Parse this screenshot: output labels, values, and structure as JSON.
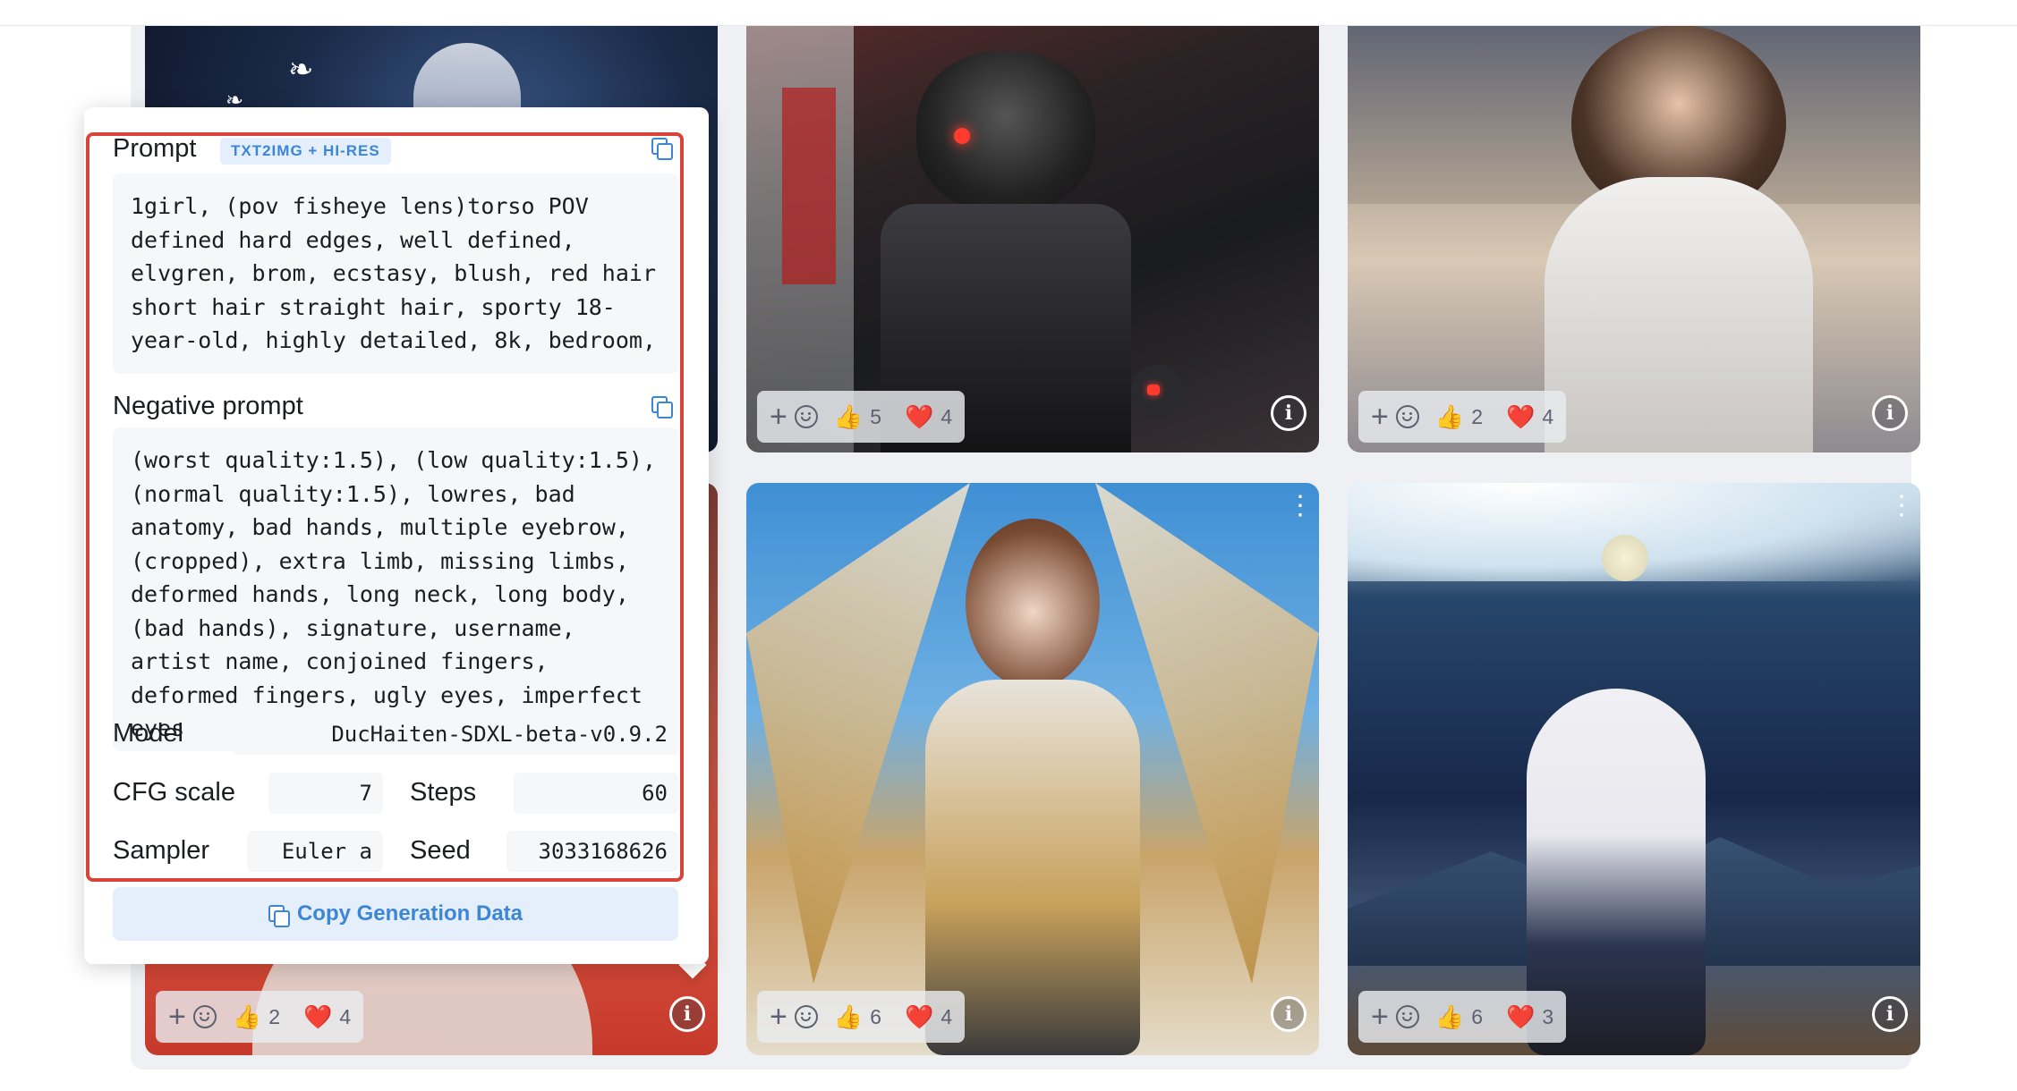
{
  "gallery": {
    "cards": [
      {
        "id": "card-1",
        "thumbs": "",
        "hearts": ""
      },
      {
        "id": "card-2",
        "thumbs": "5",
        "hearts": "4"
      },
      {
        "id": "card-3",
        "thumbs": "2",
        "hearts": "4"
      },
      {
        "id": "card-4",
        "thumbs": "2",
        "hearts": "4"
      },
      {
        "id": "card-5",
        "thumbs": "6",
        "hearts": "4"
      },
      {
        "id": "card-6",
        "thumbs": "6",
        "hearts": "3"
      }
    ],
    "thumbs_emoji": "👍",
    "heart_emoji": "❤️",
    "plus_glyph": "+",
    "info_glyph": "i"
  },
  "popover": {
    "prompt_label": "Prompt",
    "prompt_badge": "TXT2IMG + HI-RES",
    "prompt_text": "1girl, (pov fisheye lens)torso POV defined hard edges, well defined, elvgren, brom, ecstasy, blush, red hair short hair straight hair, sporty 18-year-old, highly detailed, 8k, bedroom,",
    "negative_label": "Negative prompt",
    "negative_text": "(worst quality:1.5), (low quality:1.5), (normal quality:1.5), lowres, bad anatomy, bad hands, multiple eyebrow, (cropped), extra limb, missing limbs, deformed hands, long neck, long body, (bad hands), signature, username, artist name, conjoined fingers, deformed fingers, ugly eyes, imperfect eyes",
    "model_label": "Model",
    "model_value": "DucHaiten-SDXL-beta-v0.9.2",
    "cfg_label": "CFG scale",
    "cfg_value": "7",
    "steps_label": "Steps",
    "steps_value": "60",
    "sampler_label": "Sampler",
    "sampler_value": "Euler a",
    "seed_label": "Seed",
    "seed_value": "3033168626",
    "copy_button_label": "Copy Generation Data"
  },
  "colors": {
    "accent": "#3d86d6",
    "highlight": "#d9443a",
    "heart": "#e0323c"
  }
}
